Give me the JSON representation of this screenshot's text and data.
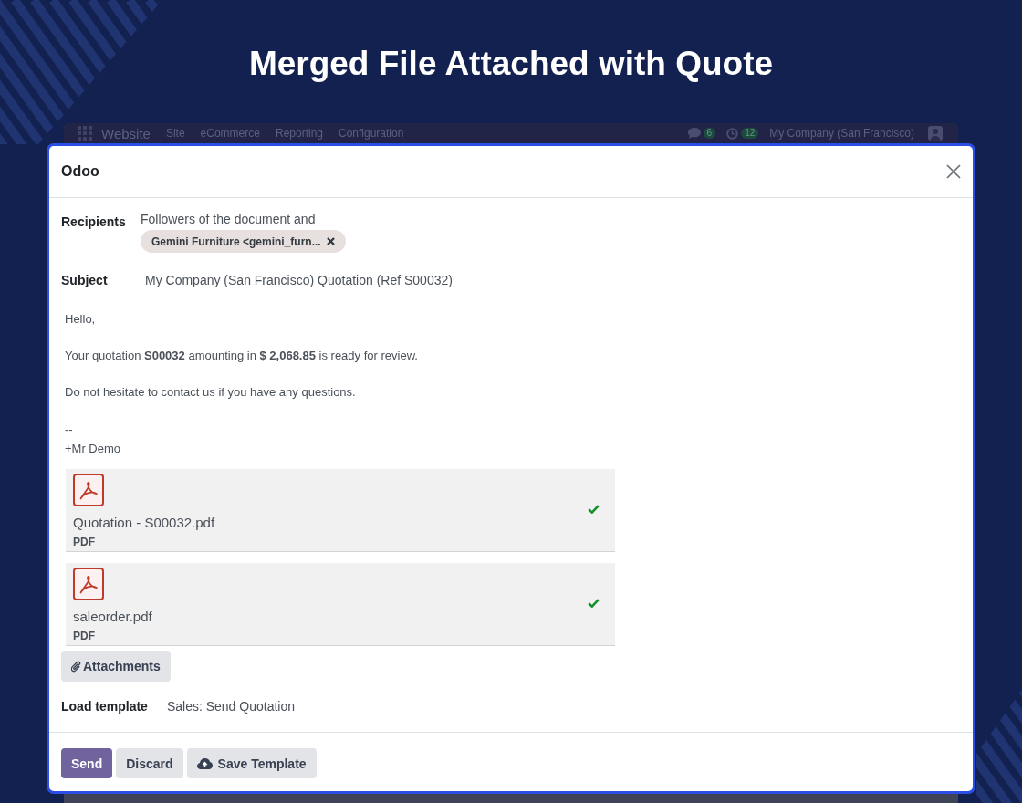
{
  "heading": {
    "title": "Merged File Attached with Quote"
  },
  "background_app": {
    "app_name": "Website",
    "menu": [
      "Site",
      "eCommerce",
      "Reporting",
      "Configuration"
    ],
    "indicators": [
      {
        "kind": "chat",
        "count": "6"
      },
      {
        "kind": "activity",
        "count": "12"
      }
    ],
    "company": "My Company (San Francisco)"
  },
  "dialog": {
    "title": "Odoo",
    "recipients": {
      "label": "Recipients",
      "text": "Followers of the document and",
      "tags": [
        "Gemini Furniture <gemini_furn..."
      ]
    },
    "subject": {
      "label": "Subject",
      "value": "My Company (San Francisco) Quotation (Ref S00032)"
    },
    "body": {
      "paragraphs": [
        "Hello,",
        "Your quotation **S00032** amounting in **$ 2,068.85** is ready for review.",
        "Do not hesitate to contact us if you have any questions."
      ],
      "signature": [
        "--",
        "+Mr Demo"
      ]
    },
    "attachments": [
      {
        "name": "Quotation - S00032.pdf",
        "type": "PDF",
        "uploaded": true
      },
      {
        "name": "saleorder.pdf",
        "type": "PDF",
        "uploaded": true
      }
    ],
    "attach_button": "Attachments",
    "template": {
      "label": "Load template",
      "value": "Sales: Send Quotation"
    },
    "buttons": [
      {
        "label": "Send",
        "kind": "primary"
      },
      {
        "label": "Discard",
        "kind": "secondary"
      },
      {
        "label": "Save Template",
        "kind": "upload"
      }
    ]
  }
}
